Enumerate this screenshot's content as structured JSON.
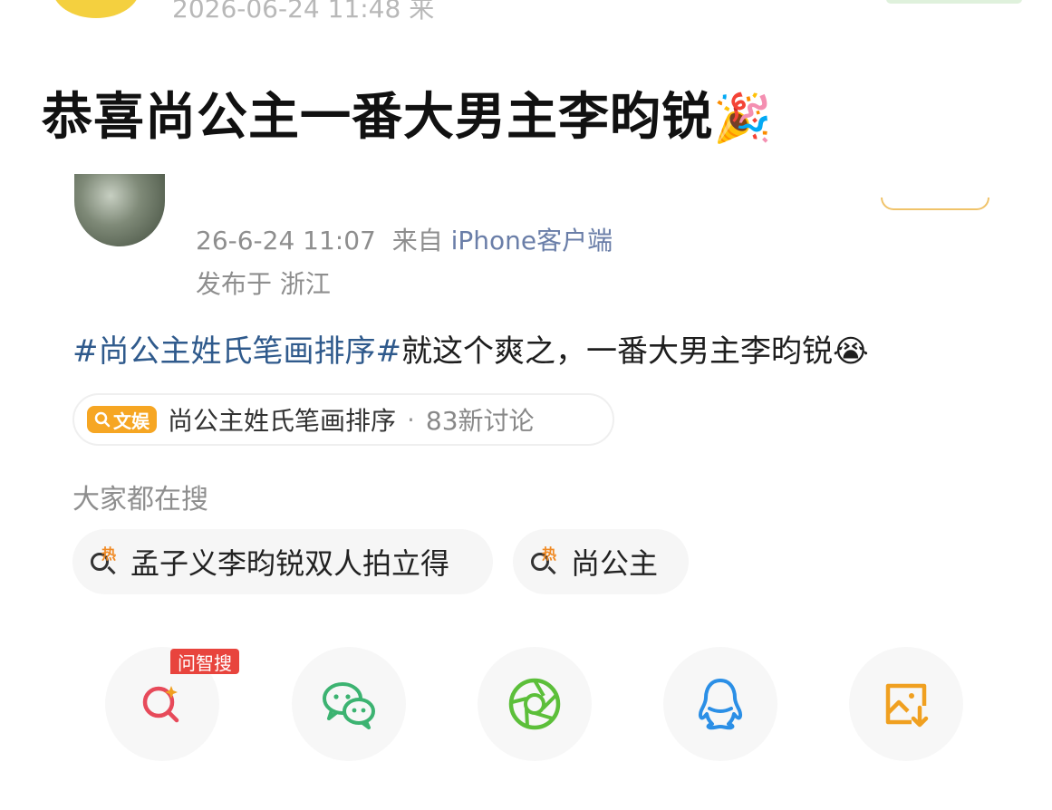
{
  "top_strip": {
    "meta_text": "2026-06-24 11:48 来"
  },
  "headline": {
    "text": "恭喜尚公主一番大男主李昀锐",
    "emoji": "🎉"
  },
  "post": {
    "time": "26-6-24 11:07",
    "from_label": "来自",
    "source": "iPhone客户端",
    "location": "发布于 浙江",
    "hashtag": "#尚公主姓氏笔画排序#",
    "body": "就这个爽之，一番大男主李昀锐",
    "body_emoji": "😭"
  },
  "topic": {
    "badge": "文娱",
    "name": "尚公主姓氏笔画排序",
    "separator": "·",
    "count": "83新讨论"
  },
  "hot_search": {
    "heading": "大家都在搜",
    "hot_mark": "热",
    "items": [
      {
        "label": "孟子义李昀锐双人拍立得"
      },
      {
        "label": "尚公主"
      }
    ]
  },
  "share": {
    "ai_badge": "问智搜",
    "buttons": [
      {
        "icon": "ai-search-icon",
        "color": "#e74a5a"
      },
      {
        "icon": "wechat-icon",
        "color": "#3cb371"
      },
      {
        "icon": "moments-icon",
        "color": "#5cbf3a"
      },
      {
        "icon": "qq-icon",
        "color": "#2b8fe6"
      },
      {
        "icon": "save-image-icon",
        "color": "#f0a020"
      }
    ]
  }
}
